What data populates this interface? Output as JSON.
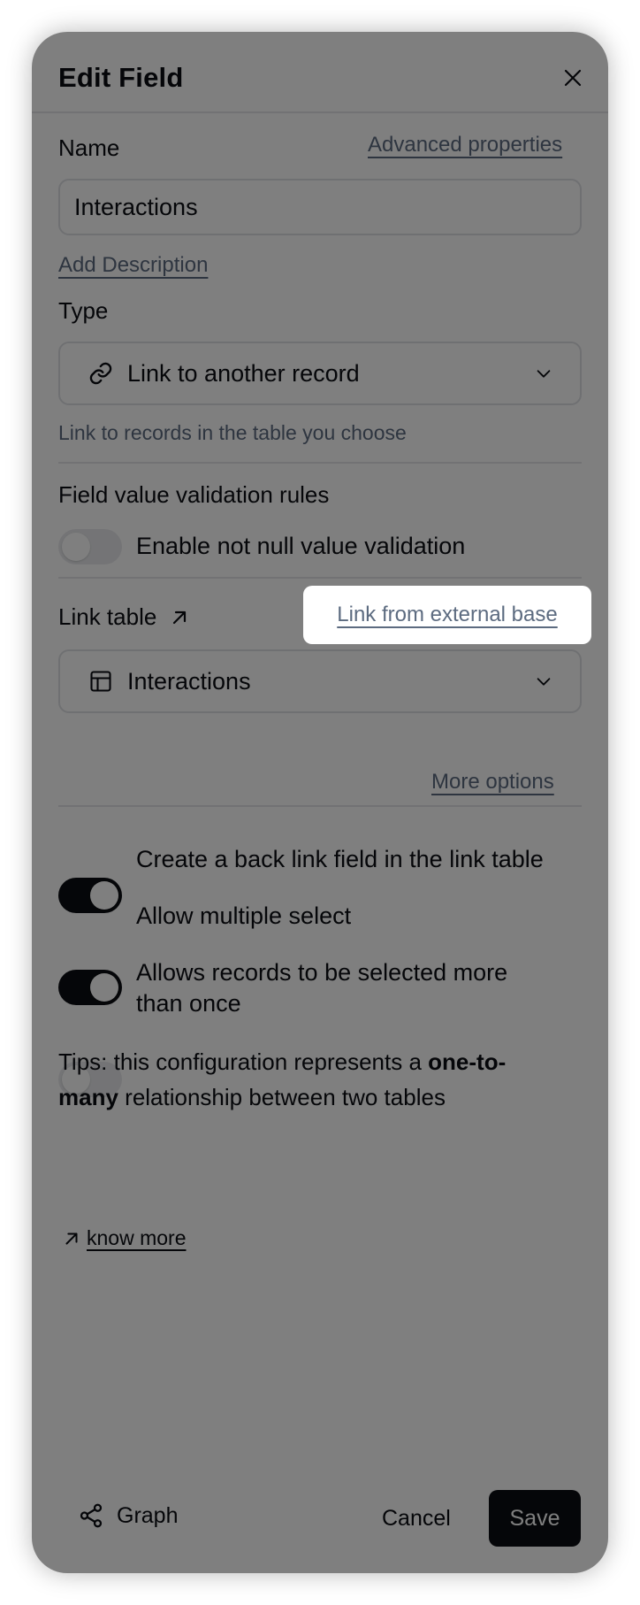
{
  "dialog": {
    "title": "Edit Field",
    "name_label": "Name",
    "advanced_properties": "Advanced properties",
    "name_value": "Interactions",
    "add_description": "Add Description",
    "type_label": "Type",
    "type_value": "Link to another record",
    "type_description": "Link to records in the table you choose",
    "validation_label": "Field value validation rules",
    "not_null_label": "Enable not null value validation",
    "link_table_label": "Link table",
    "link_external": "Link from external base",
    "link_table_value": "Interactions",
    "more_options": "More options",
    "options": [
      {
        "label": "Create a back link field in the link table",
        "on": true
      },
      {
        "label": "Allow multiple select",
        "on": true
      },
      {
        "label": "Allows records to be selected more than once",
        "on": false
      }
    ],
    "tips_prefix": "Tips: this configuration represents a",
    "tips_bold": "one-to-many",
    "tips_suffix": "relationship between two tables",
    "know_more": "know more"
  },
  "footer": {
    "graph": "Graph",
    "cancel": "Cancel",
    "save": "Save"
  },
  "icons": {
    "close": "close-icon",
    "link": "link-icon",
    "chevron": "chevron-down-icon",
    "arrow": "arrow-up-right-icon",
    "table": "table-icon",
    "share": "share-graph-icon"
  },
  "colors": {
    "primary": "#0b0d12",
    "muted_link": "#5c6b80",
    "overlay": "rgba(0,0,0,0.5)"
  }
}
